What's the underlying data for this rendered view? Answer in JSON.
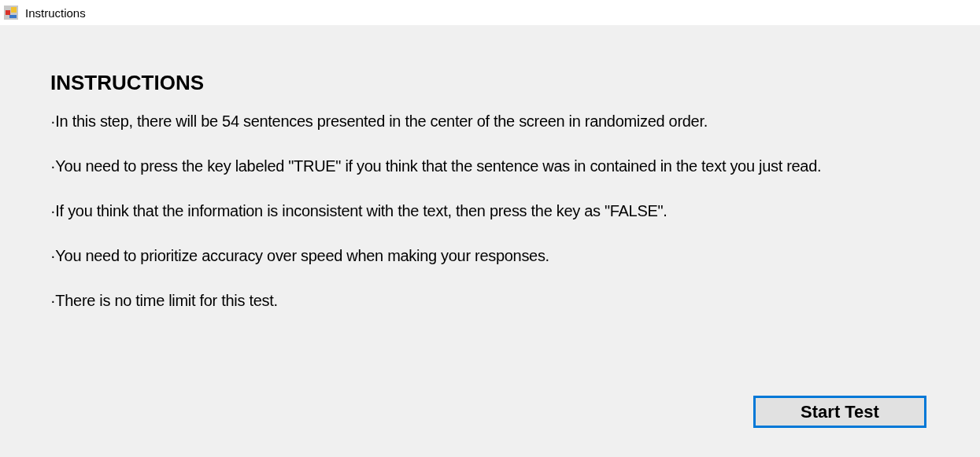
{
  "window": {
    "title": "Instructions"
  },
  "heading": "INSTRUCTIONS",
  "instructions": [
    "·In this step, there will be 54 sentences presented in the center of the screen in randomized order.",
    "·You need to press the key labeled \"TRUE\" if you think that the sentence was in contained in the text you just read.",
    "·If you think that the information is inconsistent with the text, then press the key as \"FALSE\".",
    "·You need to prioritize accuracy over speed when making your responses.",
    "·There is no time limit for this test."
  ],
  "button": {
    "label": "Start Test",
    "focused": true
  }
}
